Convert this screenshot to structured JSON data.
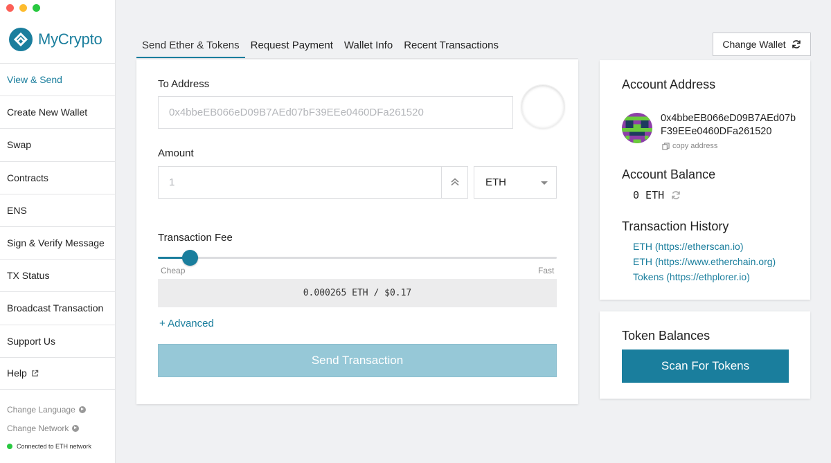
{
  "app": {
    "name": "MyCrypto",
    "brand_color": "#1a7e9d"
  },
  "sidebar": {
    "items": [
      {
        "label": "View & Send",
        "active": true
      },
      {
        "label": "Create New Wallet"
      },
      {
        "label": "Swap"
      },
      {
        "label": "Contracts"
      },
      {
        "label": "ENS"
      },
      {
        "label": "Sign & Verify Message"
      },
      {
        "label": "TX Status"
      },
      {
        "label": "Broadcast Transaction"
      },
      {
        "label": "Support Us"
      },
      {
        "label": "Help",
        "icon": "external-link-icon"
      }
    ],
    "footer": {
      "change_language": "Change Language",
      "change_network": "Change Network",
      "network_status": "Connected to ETH network",
      "status_color": "#28c840"
    }
  },
  "tabs": [
    {
      "label": "Send Ether & Tokens",
      "active": true
    },
    {
      "label": "Request Payment"
    },
    {
      "label": "Wallet Info"
    },
    {
      "label": "Recent Transactions"
    }
  ],
  "header": {
    "change_wallet_label": "Change Wallet"
  },
  "send_form": {
    "to_address_label": "To Address",
    "to_address_placeholder": "0x4bbeEB066eD09B7AEd07bF39EEe0460DFa261520",
    "amount_label": "Amount",
    "amount_placeholder": "1",
    "unit_selected": "ETH",
    "fee_label": "Transaction Fee",
    "fee_cheap": "Cheap",
    "fee_fast": "Fast",
    "fee_level": 0.08,
    "fee_value": "0.000265 ETH / $0.17",
    "advanced_label": "+ Advanced",
    "send_button": "Send Transaction"
  },
  "account": {
    "address_title": "Account Address",
    "address": "0x4bbeEB066eD09B7AEd07bF39EEe0460DFa261520",
    "copy_label": "copy address",
    "balance_title": "Account Balance",
    "balance": "0 ETH",
    "history_title": "Transaction History",
    "history_links": [
      "ETH (https://etherscan.io)",
      "ETH (https://www.etherchain.org)",
      "Tokens (https://ethplorer.io)"
    ]
  },
  "tokens": {
    "title": "Token Balances",
    "scan_button": "Scan For Tokens"
  }
}
